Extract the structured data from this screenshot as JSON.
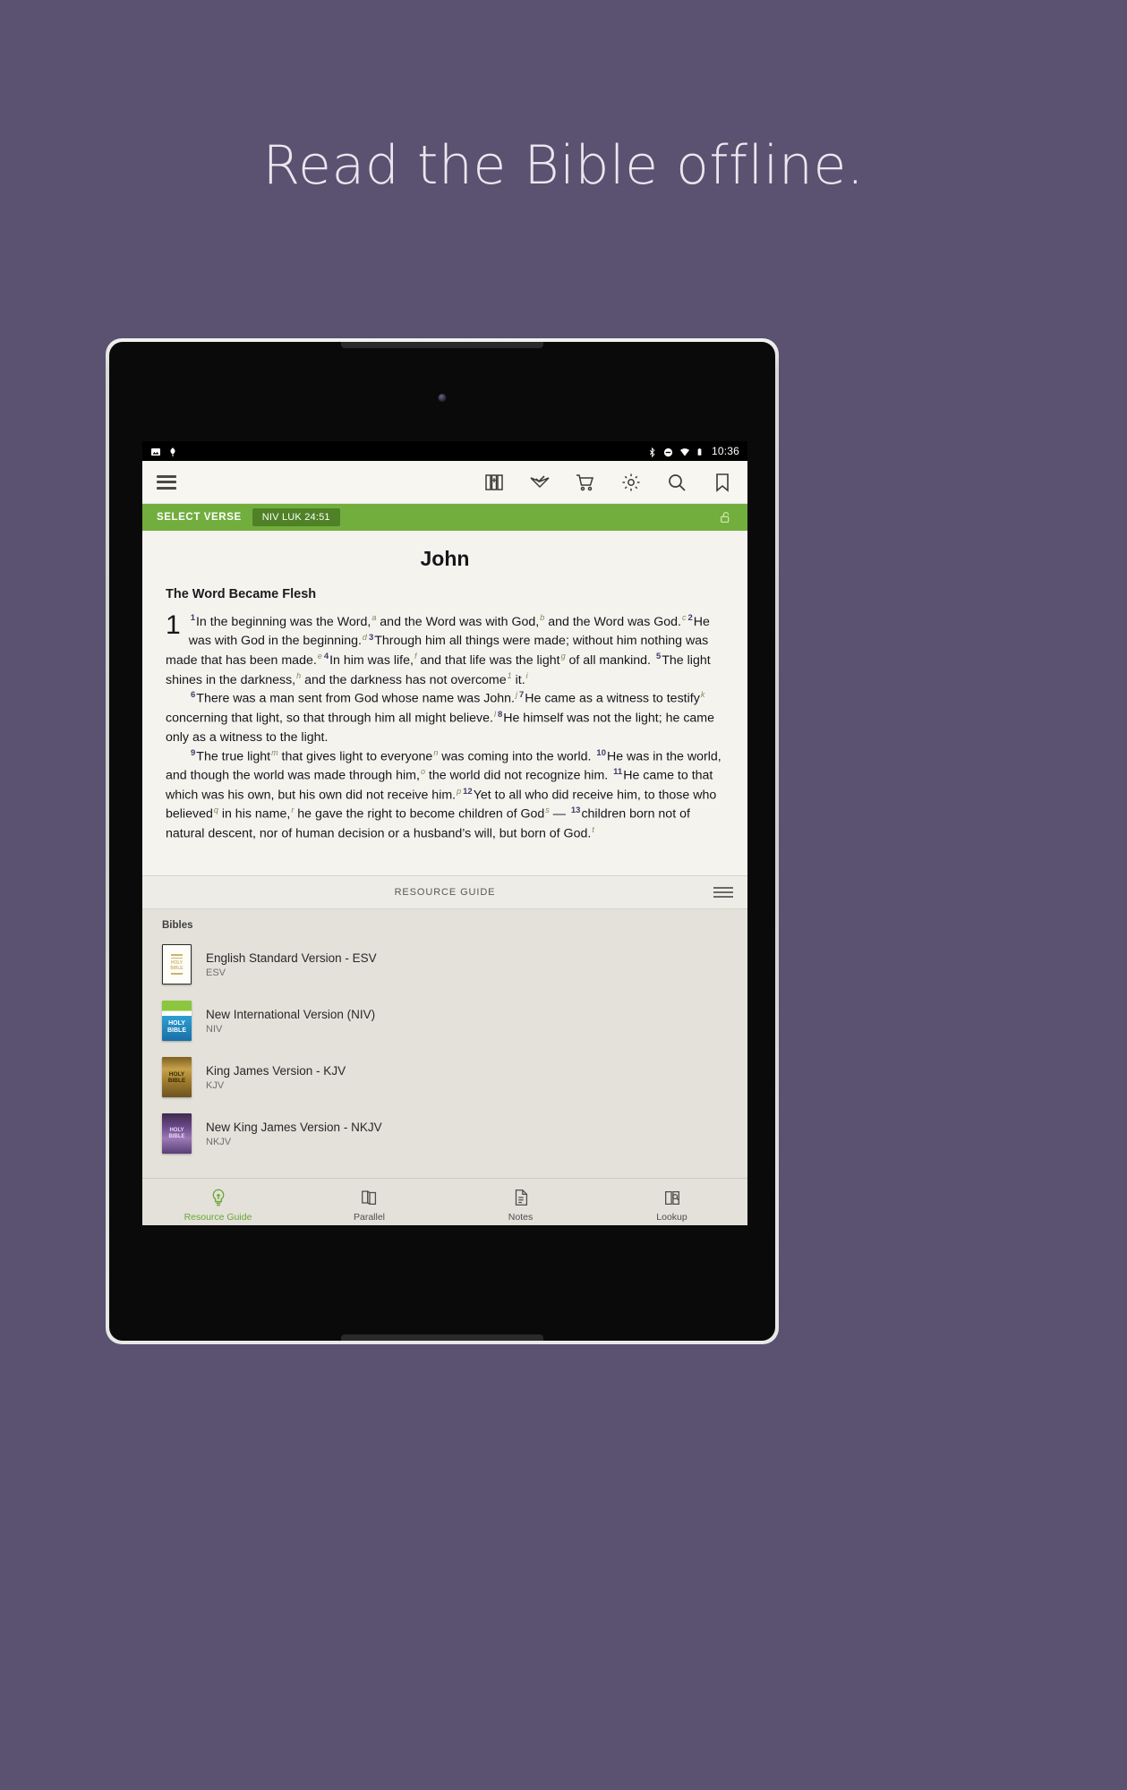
{
  "promo": {
    "headline": "Read the Bible offline."
  },
  "device": {
    "statusbar": {
      "time": "10:36",
      "left_icons": [
        "image-icon",
        "app-icon"
      ],
      "right_icons": [
        "bluetooth-icon",
        "dnd-icon",
        "wifi-icon",
        "battery-icon"
      ]
    },
    "navbar": {
      "back": "back-button",
      "home": "home-button",
      "recents": "recents-button"
    }
  },
  "toolbar": {
    "menu_label": "menu-button",
    "actions": [
      {
        "name": "library-button",
        "icon": "books-icon"
      },
      {
        "name": "reading-plan-button",
        "icon": "open-book-check-icon"
      },
      {
        "name": "store-button",
        "icon": "cart-icon"
      },
      {
        "name": "settings-button",
        "icon": "gear-icon"
      },
      {
        "name": "search-button",
        "icon": "search-icon"
      },
      {
        "name": "bookmark-button",
        "icon": "bookmark-icon"
      }
    ]
  },
  "verse_bar": {
    "label": "SELECT VERSE",
    "chip": "NIV LUK 24:51",
    "lock_icon": "unlock-icon",
    "color": "#72ae3e",
    "chip_color": "#4f8226"
  },
  "scripture": {
    "book": "John",
    "section_heading": "The Word Became Flesh",
    "chapter": "1",
    "paragraphs": [
      {
        "segments": [
          {
            "t": "v",
            "x": "1"
          },
          {
            "t": "s",
            "x": "In the beginning was the Word,"
          },
          {
            "t": "f",
            "x": "a"
          },
          {
            "t": "s",
            "x": " and the Word was with God,"
          },
          {
            "t": "f",
            "x": "b"
          },
          {
            "t": "s",
            "x": " and the Word was God."
          },
          {
            "t": "f",
            "x": "c"
          },
          {
            "t": "v",
            "x": "2"
          },
          {
            "t": "s",
            "x": "He was with God in the beginning."
          },
          {
            "t": "f",
            "x": "d"
          },
          {
            "t": "v",
            "x": "3"
          },
          {
            "t": "s",
            "x": "Through him all things were made; without him nothing was made that has been made."
          },
          {
            "t": "f",
            "x": "e"
          },
          {
            "t": "v",
            "x": "4"
          },
          {
            "t": "s",
            "x": "In him was life,"
          },
          {
            "t": "f",
            "x": "f"
          },
          {
            "t": "s",
            "x": " and that life was the light"
          },
          {
            "t": "f",
            "x": "g"
          },
          {
            "t": "s",
            "x": " of all mankind. "
          },
          {
            "t": "v",
            "x": "5"
          },
          {
            "t": "s",
            "x": "The light shines in the darkness,"
          },
          {
            "t": "f",
            "x": "h"
          },
          {
            "t": "s",
            "x": " and the darkness has not overcome"
          },
          {
            "t": "f",
            "x": "1"
          },
          {
            "t": "s",
            "x": " it."
          },
          {
            "t": "f",
            "x": "i"
          }
        ]
      },
      {
        "indent": true,
        "segments": [
          {
            "t": "v",
            "x": "6"
          },
          {
            "t": "s",
            "x": "There was a man sent from God whose name was John."
          },
          {
            "t": "f",
            "x": "j"
          },
          {
            "t": "v",
            "x": "7"
          },
          {
            "t": "s",
            "x": "He came as a witness to testify"
          },
          {
            "t": "f",
            "x": "k"
          },
          {
            "t": "s",
            "x": " concerning that light, so that through him all might believe."
          },
          {
            "t": "f",
            "x": "l"
          },
          {
            "t": "v",
            "x": "8"
          },
          {
            "t": "s",
            "x": "He himself was not the light; he came only as a witness to the light."
          }
        ]
      },
      {
        "indent": true,
        "segments": [
          {
            "t": "v",
            "x": "9"
          },
          {
            "t": "s",
            "x": "The true light"
          },
          {
            "t": "f",
            "x": "m"
          },
          {
            "t": "s",
            "x": " that gives light to everyone"
          },
          {
            "t": "f",
            "x": "n"
          },
          {
            "t": "s",
            "x": " was coming into the world. "
          },
          {
            "t": "v",
            "x": "10"
          },
          {
            "t": "s",
            "x": "He was in the world, and though the world was made through him,"
          },
          {
            "t": "f",
            "x": "o"
          },
          {
            "t": "s",
            "x": " the world did not recognize him. "
          },
          {
            "t": "v",
            "x": "11"
          },
          {
            "t": "s",
            "x": "He came to that which was his own, but his own did not receive him."
          },
          {
            "t": "f",
            "x": "p"
          },
          {
            "t": "v",
            "x": "12"
          },
          {
            "t": "s",
            "x": "Yet to all who did receive him, to those who believed"
          },
          {
            "t": "f",
            "x": "q"
          },
          {
            "t": "s",
            "x": " in his name,"
          },
          {
            "t": "f",
            "x": "r"
          },
          {
            "t": "s",
            "x": " he gave the right to become children of God"
          },
          {
            "t": "f",
            "x": "s"
          },
          {
            "t": "s",
            "x": " — "
          },
          {
            "t": "v",
            "x": "13"
          },
          {
            "t": "s",
            "x": "children born not of natural descent, nor of human decision or a husband’s will, but born of God."
          },
          {
            "t": "f",
            "x": "t"
          }
        ]
      }
    ]
  },
  "resource_guide": {
    "bar_label": "RESOURCE GUIDE",
    "grip_icon": "drag-handle-icon",
    "section_title": "Bibles",
    "items": [
      {
        "name": "English Standard Version - ESV",
        "abbr": "ESV",
        "cover": "esv"
      },
      {
        "name": "New International Version (NIV)",
        "abbr": "NIV",
        "cover": "niv"
      },
      {
        "name": "King James Version - KJV",
        "abbr": "KJV",
        "cover": "kjv"
      },
      {
        "name": "New King James Version - NKJV",
        "abbr": "NKJV",
        "cover": "nkjv"
      }
    ]
  },
  "tabs": [
    {
      "label": "Resource Guide",
      "icon": "lightbulb-icon",
      "active": true
    },
    {
      "label": "Parallel",
      "icon": "parallel-books-icon",
      "active": false
    },
    {
      "label": "Notes",
      "icon": "notes-document-icon",
      "active": false
    },
    {
      "label": "Lookup",
      "icon": "lookup-book-icon",
      "active": false
    }
  ],
  "colors": {
    "background": "#5b5170",
    "accent_green": "#72ae3e",
    "paper": "#f4f3ee",
    "panel": "#e3e1d9"
  }
}
